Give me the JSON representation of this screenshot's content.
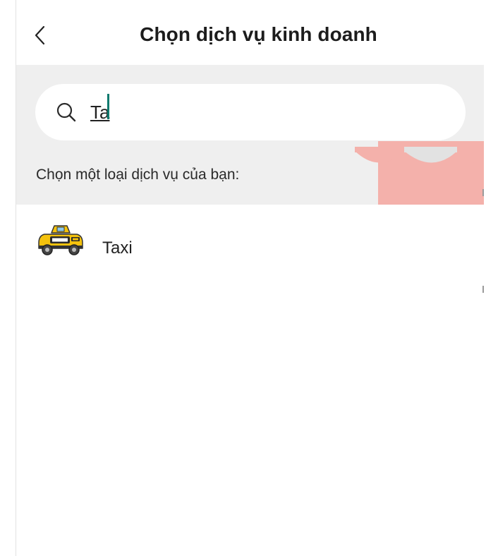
{
  "header": {
    "title": "Chọn dịch vụ kinh doanh"
  },
  "search": {
    "value": "Ta",
    "hint": "Chọn một loại dịch vụ của bạn:"
  },
  "results": [
    {
      "label": "Taxi",
      "icon": "taxi-icon"
    }
  ],
  "colors": {
    "search_band": "#efefef",
    "caret": "#0f7a6e",
    "awning": "#f4b1ab"
  }
}
